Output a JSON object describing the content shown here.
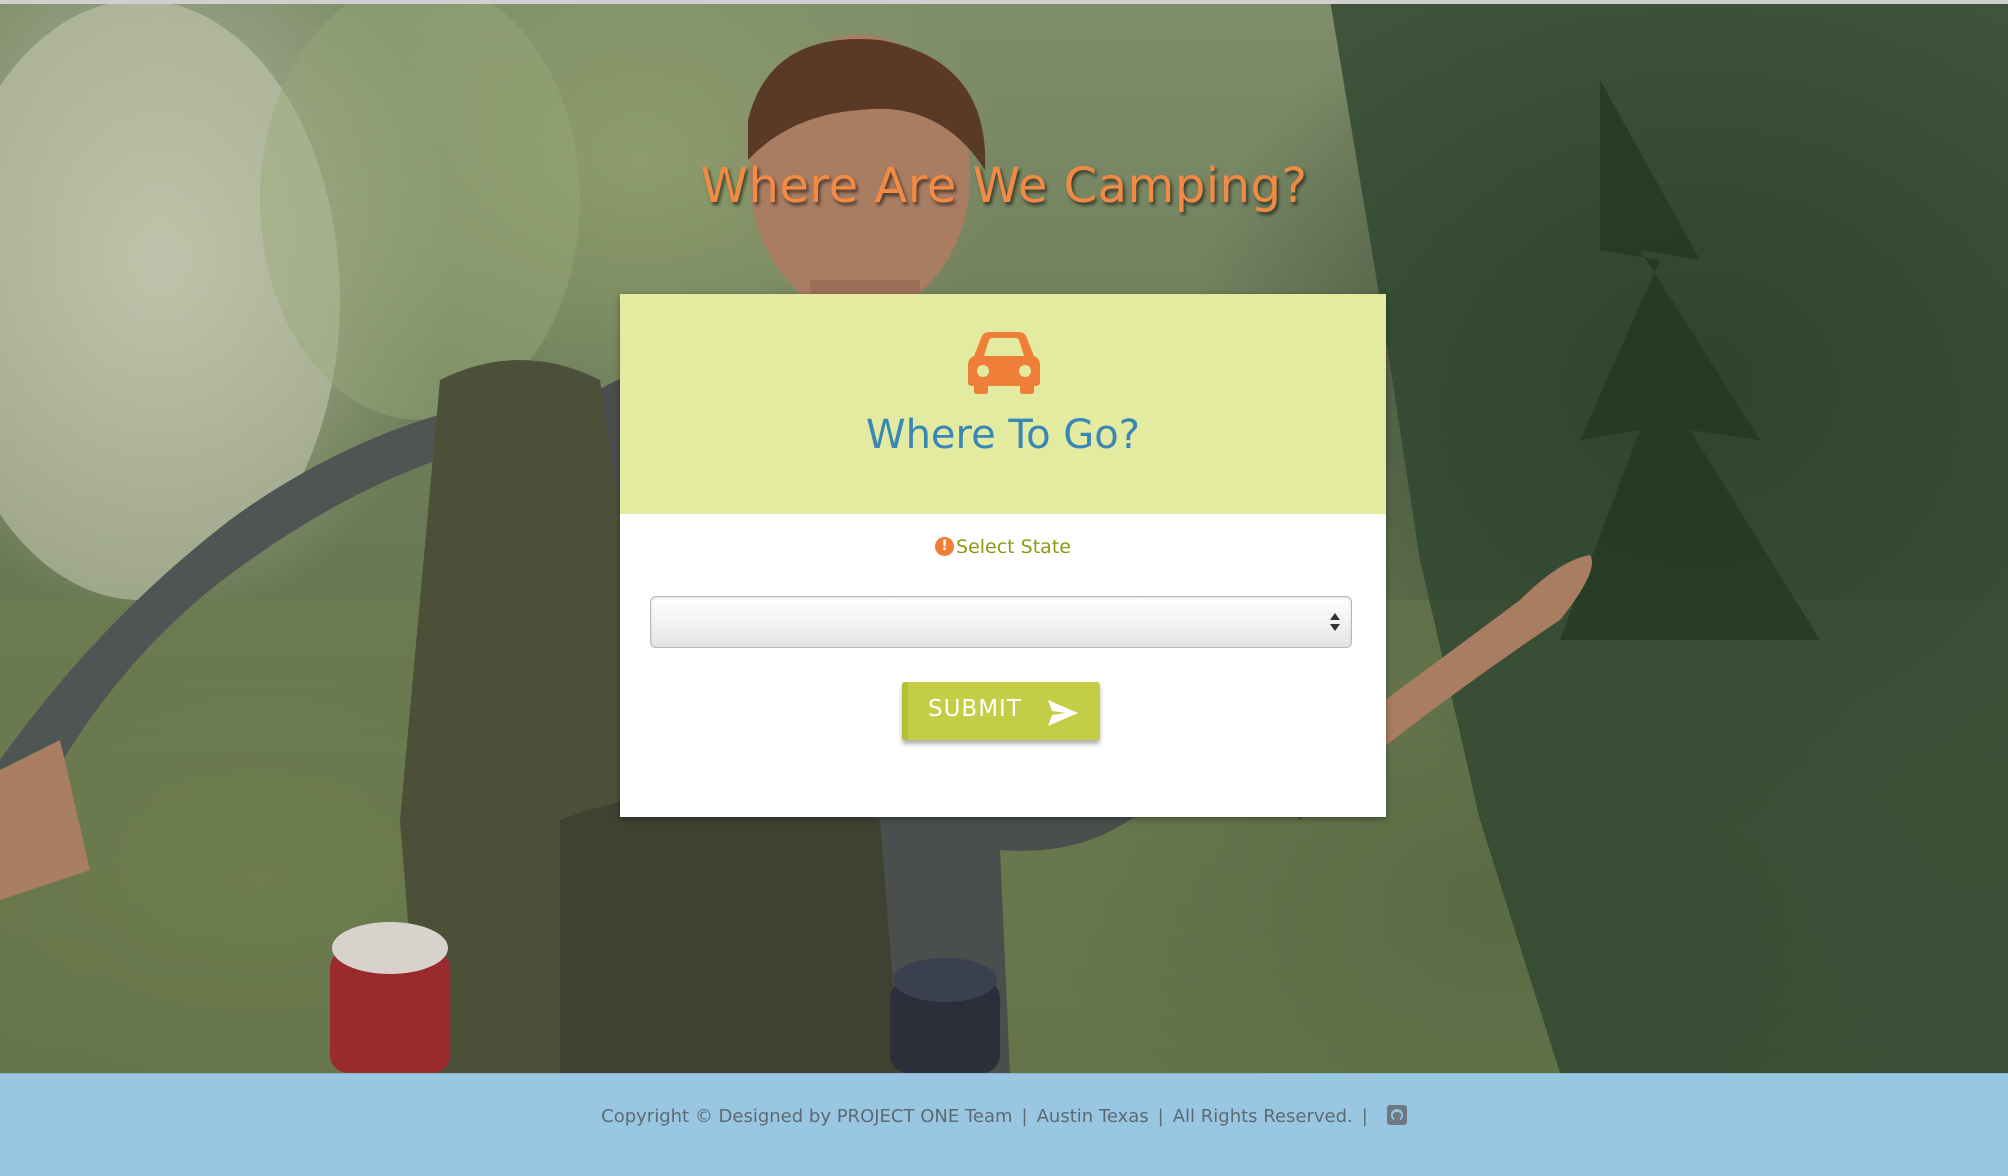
{
  "page": {
    "heading": "Where Are We Camping?"
  },
  "card": {
    "icon": "car-icon",
    "title": "Where To Go?",
    "field_label": "Select State",
    "field_icon": "exclamation-circle-icon",
    "select_value": "",
    "submit_label": "SUBMIT",
    "submit_icon": "send-icon"
  },
  "footer": {
    "copyright": "Copyright © Designed by PROJECT ONE Team",
    "location": "Austin Texas",
    "rights": "All Rights Reserved.",
    "separator": "|",
    "social_icon": "github-icon"
  },
  "colors": {
    "heading": "#f08a44",
    "card_header_bg": "#e3eba1",
    "card_title": "#3a87b5",
    "label": "#8c9a16",
    "warning": "#ef7e38",
    "button": "#c3cd45",
    "footer_bg": "#99c7e2",
    "footer_text": "#5d6a73"
  }
}
